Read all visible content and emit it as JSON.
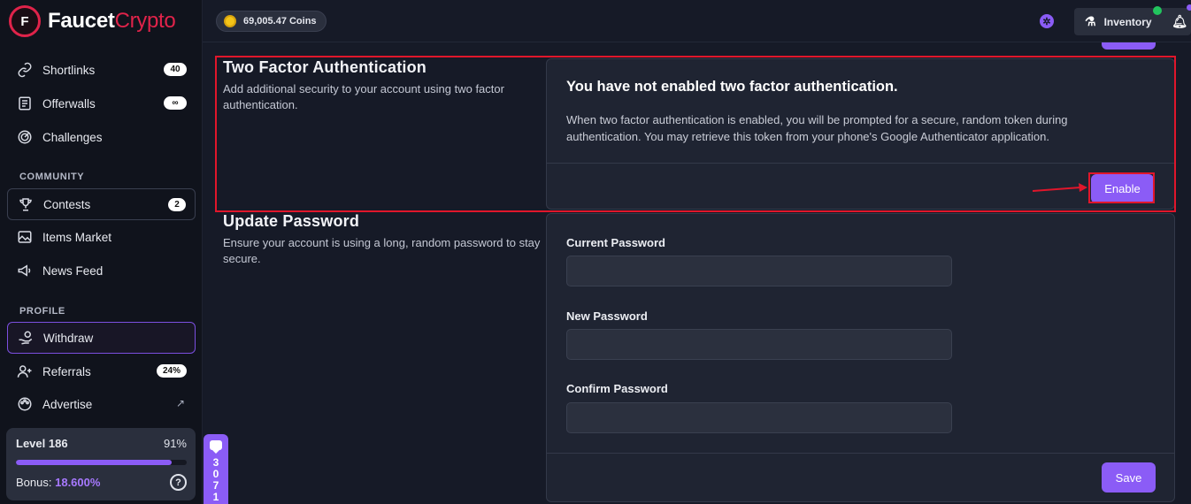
{
  "brand": {
    "initial": "F",
    "name_part1": "Faucet",
    "name_part2": "Crypto"
  },
  "topbar": {
    "coins": "69,005.47 Coins",
    "inventory_label": "Inventory"
  },
  "sidebar": {
    "items": [
      {
        "label": "Shortlinks",
        "badge": "40",
        "icon": "link-icon"
      },
      {
        "label": "Offerwalls",
        "badge": "∞",
        "icon": "list-icon"
      },
      {
        "label": "Challenges",
        "icon": "target-icon"
      }
    ],
    "community_title": "COMMUNITY",
    "community": [
      {
        "label": "Contests",
        "badge": "2",
        "icon": "trophy-icon"
      },
      {
        "label": "Items Market",
        "icon": "image-icon"
      },
      {
        "label": "News Feed",
        "icon": "megaphone-icon"
      }
    ],
    "profile_title": "PROFILE",
    "profile": [
      {
        "label": "Withdraw",
        "icon": "hand-coins-icon"
      },
      {
        "label": "Referrals",
        "badge": "24%",
        "icon": "users-icon"
      },
      {
        "label": "Advertise",
        "icon": "palette-icon"
      }
    ]
  },
  "level": {
    "label": "Level 186",
    "percent": "91%",
    "progress": 0.91,
    "bonus_label": "Bonus:",
    "bonus_value": "18.600%"
  },
  "two_factor": {
    "title": "Two Factor Authentication",
    "description": "Add additional security to your account using two factor authentication.",
    "card_title": "You have not enabled two factor authentication.",
    "card_text": "When two factor authentication is enabled, you will be prompted for a secure, random token during authentication. You may retrieve this token from your phone's Google Authenticator application.",
    "enable_label": "Enable"
  },
  "password": {
    "title": "Update Password",
    "description": "Ensure your account is using a long, random password to stay secure.",
    "current_label": "Current Password",
    "new_label": "New Password",
    "confirm_label": "Confirm Password",
    "save_label": "Save"
  },
  "chat": {
    "count": "3071"
  },
  "colors": {
    "accent": "#8b5cf6",
    "brand_red": "#e0234a",
    "highlight_red": "#e0162b",
    "online_green": "#22c55e"
  }
}
